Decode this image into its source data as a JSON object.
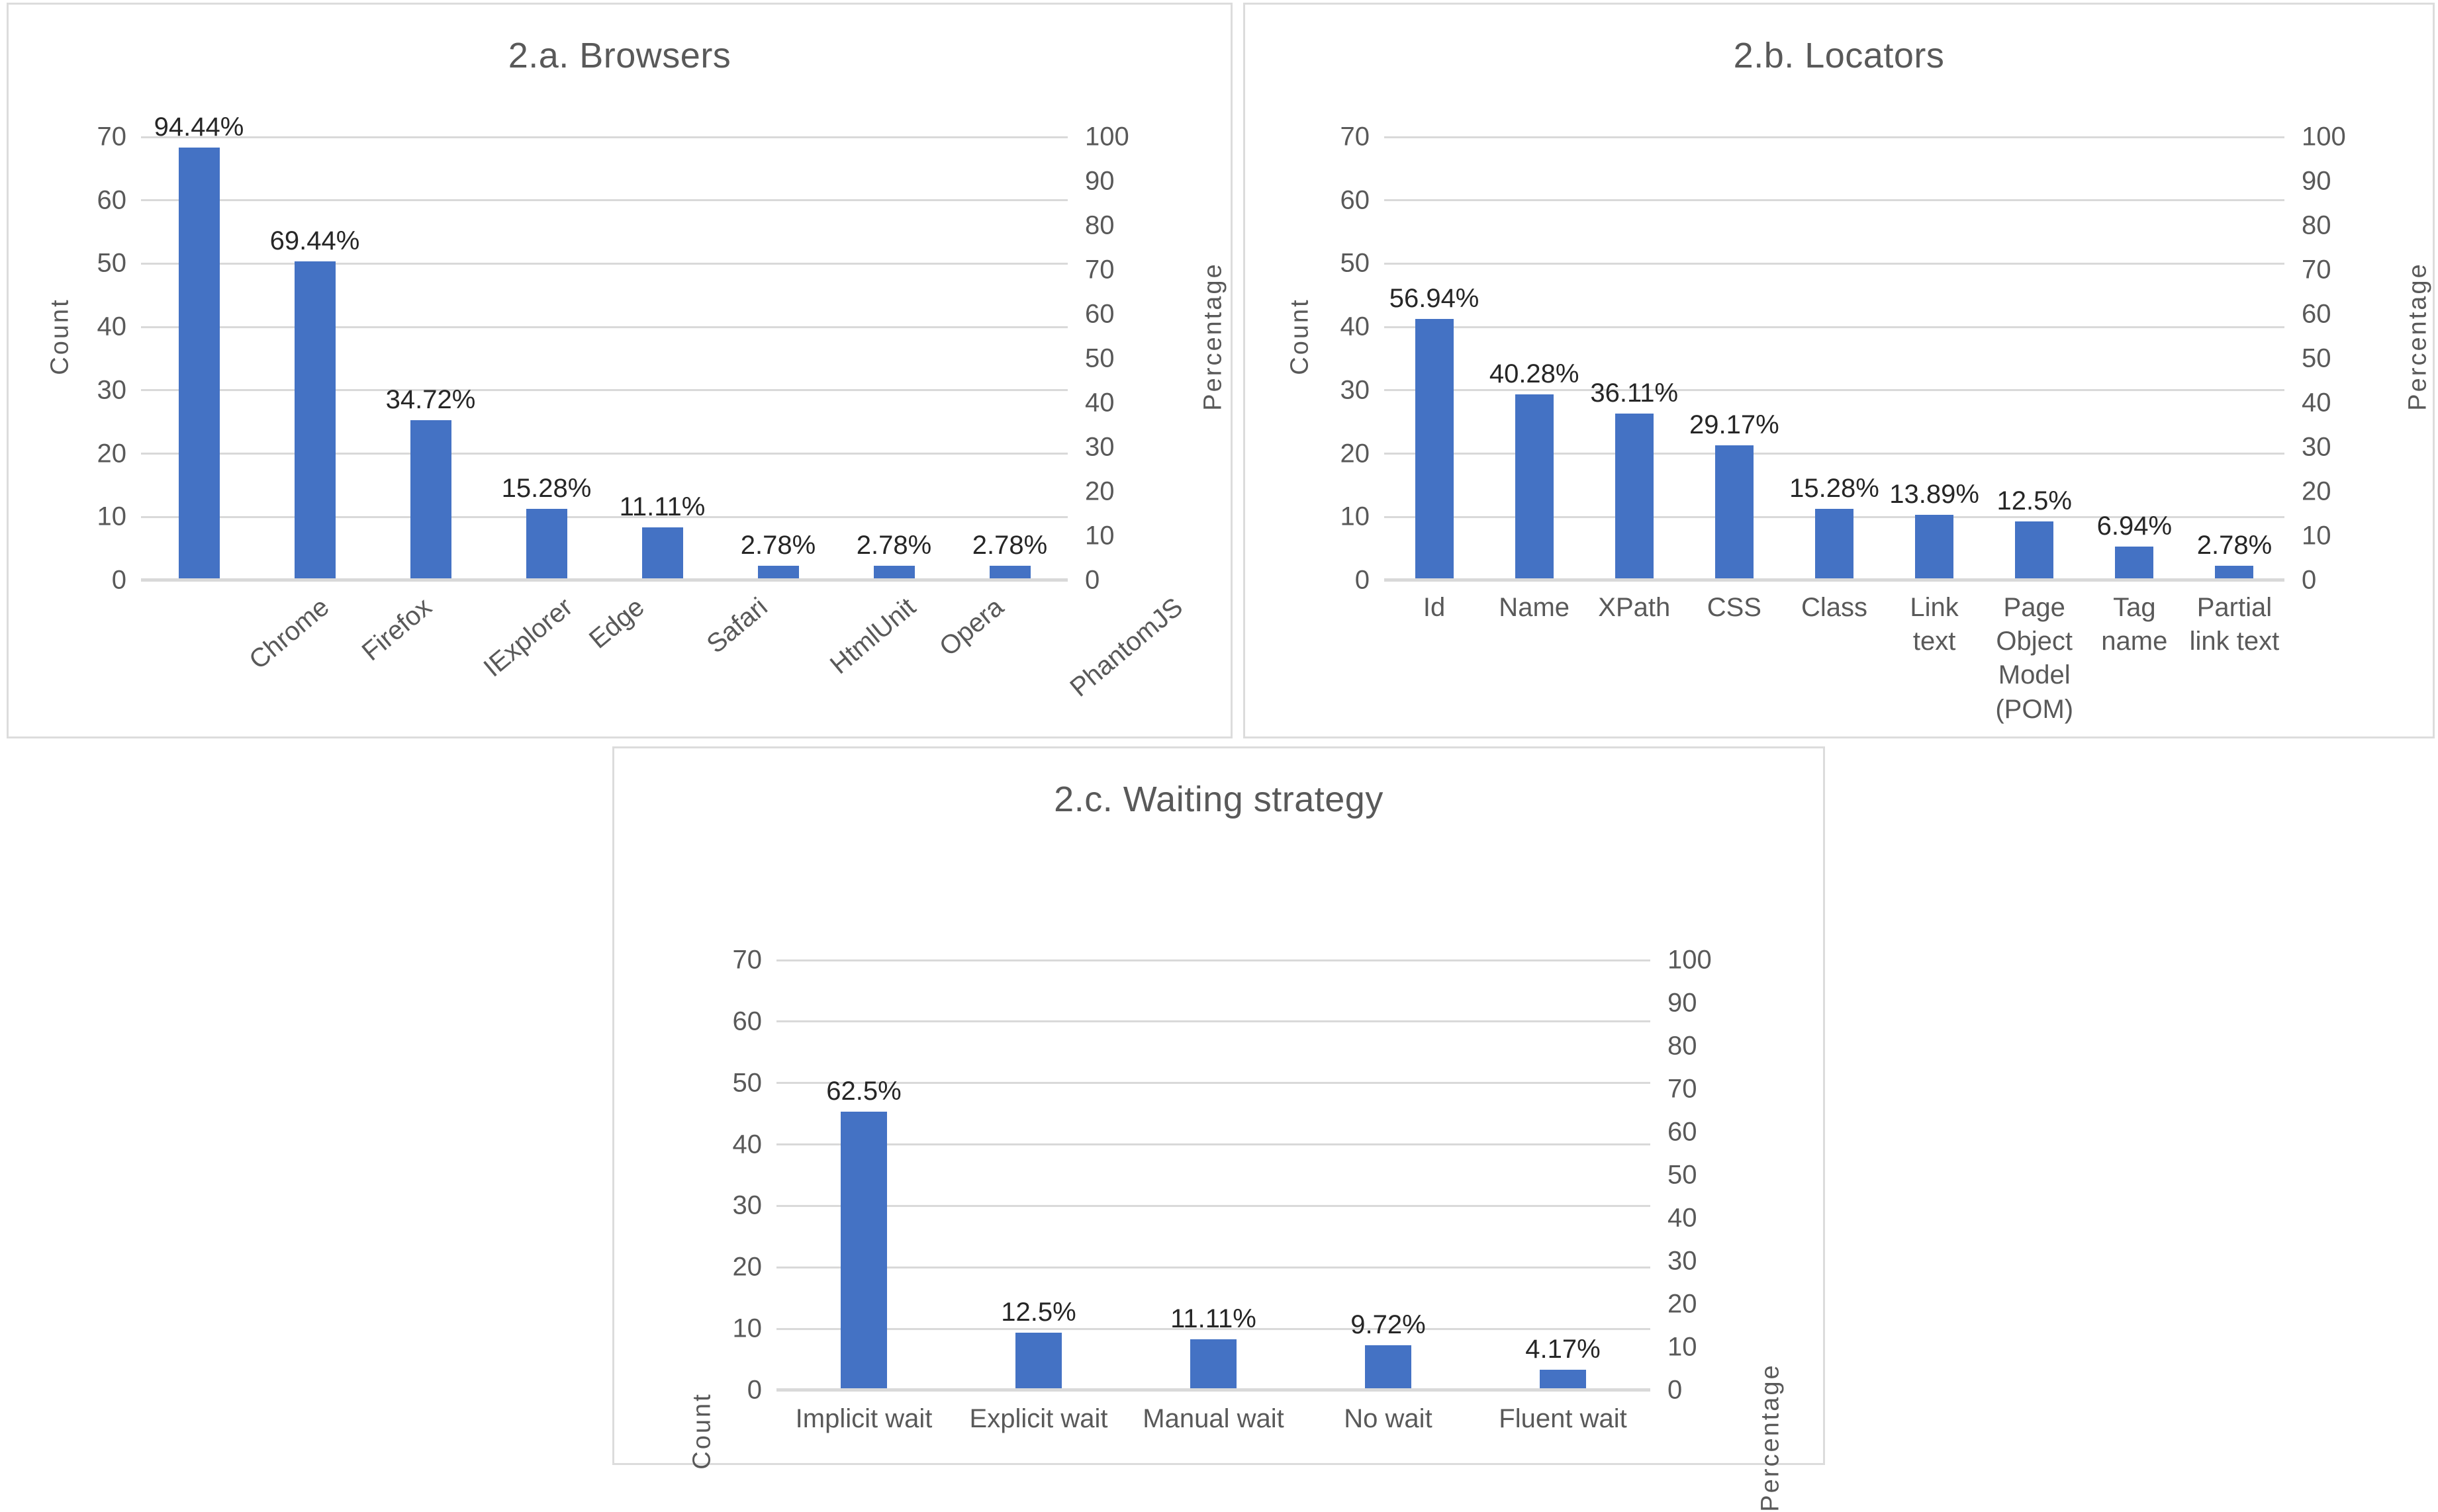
{
  "colors": {
    "bar": "#4472C4",
    "gridline": "#D9D9D9",
    "title_text": "#595959",
    "tick_text": "#595959",
    "label_text": "#262626",
    "panel_border": "#DCDCDC"
  },
  "axes": {
    "left_title": "Count",
    "right_title": "Percentage",
    "left_ticks": [
      "0",
      "10",
      "20",
      "30",
      "40",
      "50",
      "60",
      "70"
    ],
    "right_ticks": [
      "0",
      "10",
      "20",
      "30",
      "40",
      "50",
      "60",
      "70",
      "80",
      "90",
      "100"
    ],
    "left_min": 0,
    "left_max": 70,
    "right_min": 0,
    "right_max": 100
  },
  "charts": [
    {
      "id": "browsers",
      "title": "2.a. Browsers",
      "labels_rotated": true
    },
    {
      "id": "locators",
      "title": "2.b. Locators",
      "labels_rotated": false
    },
    {
      "id": "waiting-strategy",
      "title": "2.c. Waiting strategy",
      "labels_rotated": false
    }
  ],
  "chart_data": [
    {
      "type": "bar",
      "title": "2.a. Browsers",
      "xlabel": "",
      "ylabel": "Count",
      "y2label": "Percentage",
      "ylim": [
        0,
        70
      ],
      "y2lim": [
        0,
        100
      ],
      "grid": true,
      "legend": "none",
      "categories": [
        "Chrome",
        "Firefox",
        "IExplorer",
        "Edge",
        "Safari",
        "HtmlUnit",
        "Opera",
        "PhantomJS"
      ],
      "values": [
        68,
        50,
        25,
        11,
        8,
        2,
        2,
        2
      ],
      "data_labels": [
        "94.44%",
        "69.44%",
        "34.72%",
        "15.28%",
        "11.11%",
        "2.78%",
        "2.78%",
        "2.78%"
      ],
      "percentages": [
        94.44,
        69.44,
        34.72,
        15.28,
        11.11,
        2.78,
        2.78,
        2.78
      ]
    },
    {
      "type": "bar",
      "title": "2.b. Locators",
      "xlabel": "",
      "ylabel": "Count",
      "y2label": "Percentage",
      "ylim": [
        0,
        70
      ],
      "y2lim": [
        0,
        100
      ],
      "grid": true,
      "legend": "none",
      "categories": [
        "Id",
        "Name",
        "XPath",
        "CSS",
        "Class",
        "Link text",
        "Page Object Model (POM)",
        "Tag name",
        "Partial link text"
      ],
      "values": [
        41,
        29,
        26,
        21,
        11,
        10,
        9,
        5,
        2
      ],
      "data_labels": [
        "56.94%",
        "40.28%",
        "36.11%",
        "29.17%",
        "15.28%",
        "13.89%",
        "12.5%",
        "6.94%",
        "2.78%"
      ],
      "percentages": [
        56.94,
        40.28,
        36.11,
        29.17,
        15.28,
        13.89,
        12.5,
        6.94,
        2.78
      ]
    },
    {
      "type": "bar",
      "title": "2.c. Waiting strategy",
      "xlabel": "",
      "ylabel": "Count",
      "y2label": "Percentage",
      "ylim": [
        0,
        70
      ],
      "y2lim": [
        0,
        100
      ],
      "grid": true,
      "legend": "none",
      "categories": [
        "Implicit wait",
        "Explicit wait",
        "Manual wait",
        "No wait",
        "Fluent wait"
      ],
      "values": [
        45,
        9,
        8,
        7,
        3
      ],
      "data_labels": [
        "62.5%",
        "12.5%",
        "11.11%",
        "9.72%",
        "4.17%"
      ],
      "percentages": [
        62.5,
        12.5,
        11.11,
        9.72,
        4.17
      ]
    }
  ]
}
